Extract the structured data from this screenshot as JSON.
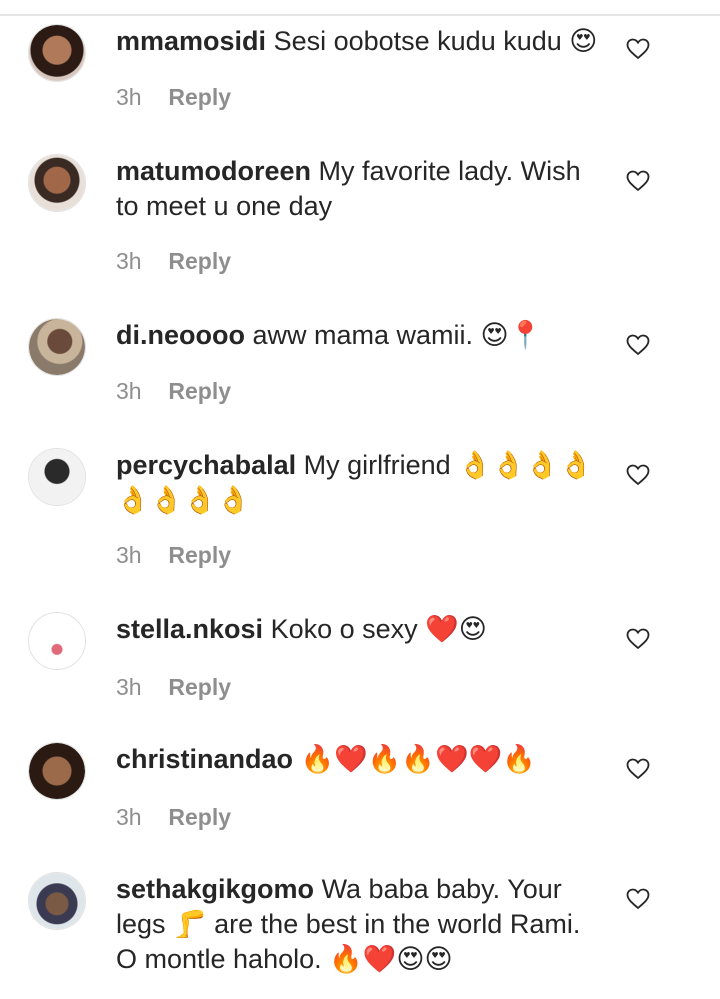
{
  "comments": [
    {
      "username": "mmamosidi",
      "text": "Sesi oobotse kudu kudu 😍",
      "time": "3h",
      "reply": "Reply"
    },
    {
      "username": "matumodoreen",
      "text": "My favorite lady. Wish to meet u one day",
      "time": "3h",
      "reply": "Reply"
    },
    {
      "username": "di.neoooo",
      "text": "aww mama wamii. 😍📍",
      "time": "3h",
      "reply": "Reply"
    },
    {
      "username": "percychabalal",
      "text": "My girlfriend 👌👌👌👌👌👌👌👌",
      "time": "3h",
      "reply": "Reply"
    },
    {
      "username": "stella.nkosi",
      "text": "Koko o sexy ❤️😍",
      "time": "3h",
      "reply": "Reply"
    },
    {
      "username": "christinandao",
      "text": "🔥❤️🔥🔥❤️❤️🔥",
      "time": "3h",
      "reply": "Reply"
    },
    {
      "username": "sethakgikgomo",
      "text": "Wa baba baby. Your legs 🦵 are the best in the world Rami. O montle haholo. 🔥❤️😍😍",
      "time": "",
      "reply": ""
    }
  ],
  "icons": {
    "like": "heart-outline-icon",
    "avatar": "avatar"
  },
  "colors": {
    "text": "#262626",
    "meta": "#8e8e8e",
    "divider": "#e6e6e6"
  }
}
